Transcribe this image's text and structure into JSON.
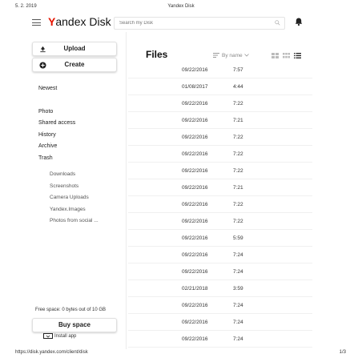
{
  "print_header": {
    "date": "5. 2. 2019",
    "title": "Yandex Disk"
  },
  "print_footer": {
    "url": "https://disk.yandex.com/client/disk",
    "page": "1/3"
  },
  "topbar": {
    "logo_y": "Y",
    "logo_rest": "andex Disk",
    "search_placeholder": "Search my Disk",
    "icons": {
      "menu": "hamburger-menu-icon",
      "search": "search-icon",
      "notifications": "bell-icon"
    }
  },
  "sidebar": {
    "upload_label": "Upload",
    "create_label": "Create",
    "nav": [
      "Newest",
      "Photo",
      "Shared access",
      "History",
      "Archive",
      "Trash"
    ],
    "folders": [
      "Downloads",
      "Screenshots",
      "Camera Uploads",
      "Yandex.Images",
      "Photos from social ..."
    ],
    "free_space": "Free space: 0 bytes out of 10 GB",
    "buy_label": "Buy space",
    "install_label": "Install app"
  },
  "main": {
    "title": "Files",
    "sort_label": "By name",
    "rows": [
      {
        "date": "09/22/2016",
        "time": "7:57"
      },
      {
        "date": "01/08/2017",
        "time": "4:44"
      },
      {
        "date": "09/22/2016",
        "time": "7:22"
      },
      {
        "date": "09/22/2016",
        "time": "7:21"
      },
      {
        "date": "09/22/2016",
        "time": "7:22"
      },
      {
        "date": "09/22/2016",
        "time": "7:22"
      },
      {
        "date": "09/22/2016",
        "time": "7:22"
      },
      {
        "date": "09/22/2016",
        "time": "7:21"
      },
      {
        "date": "09/22/2016",
        "time": "7:22"
      },
      {
        "date": "09/22/2016",
        "time": "7:22"
      },
      {
        "date": "09/22/2016",
        "time": "5:59"
      },
      {
        "date": "09/22/2016",
        "time": "7:24"
      },
      {
        "date": "09/22/2016",
        "time": "7:24"
      },
      {
        "date": "02/21/2018",
        "time": "3:59"
      },
      {
        "date": "09/22/2016",
        "time": "7:24"
      },
      {
        "date": "09/22/2016",
        "time": "7:24"
      },
      {
        "date": "09/22/2016",
        "time": "7:24"
      }
    ]
  },
  "colors": {
    "brand_red": "#e61400",
    "text": "#222222",
    "muted": "#888888"
  }
}
